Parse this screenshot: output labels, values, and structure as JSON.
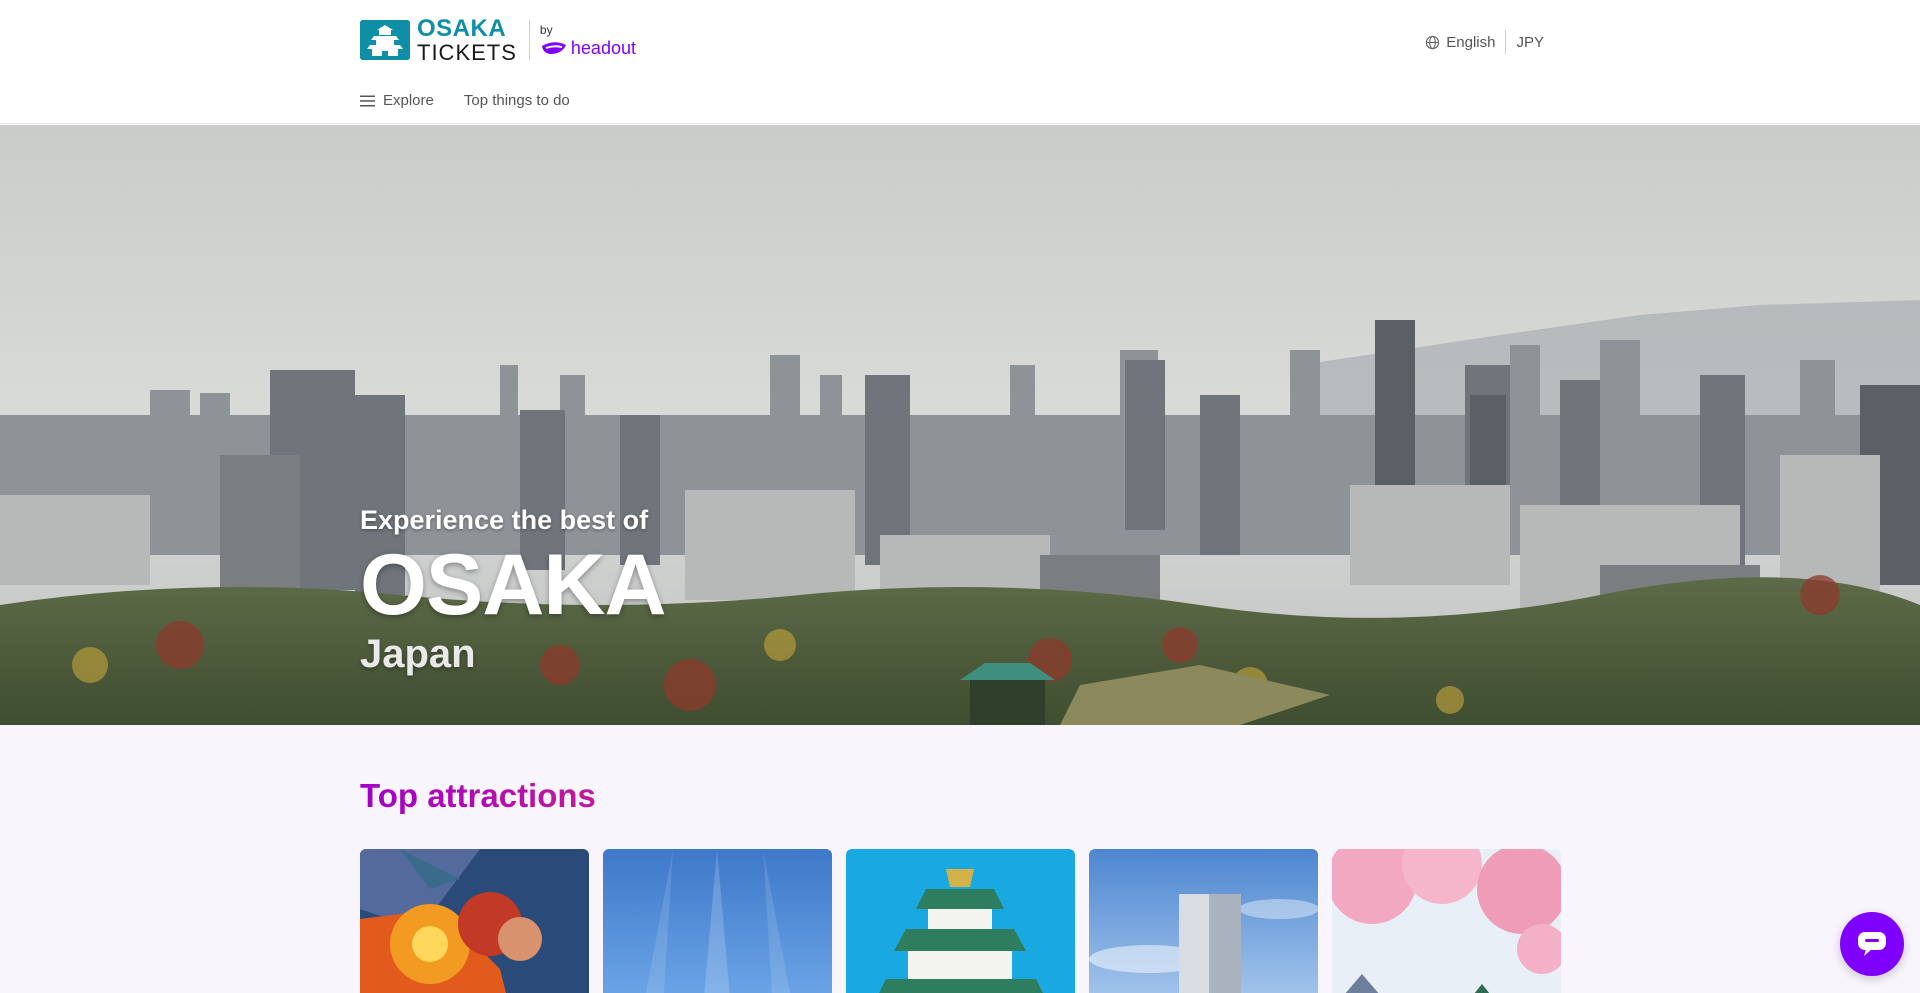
{
  "header": {
    "logo": {
      "line1": "OSAKA",
      "line2": "TICKETS",
      "by": "by",
      "brand": "headout"
    },
    "language": "English",
    "currency": "JPY",
    "nav": {
      "explore": "Explore",
      "top_things": "Top things to do"
    }
  },
  "hero": {
    "subtitle": "Experience the best of",
    "title": "OSAKA",
    "country": "Japan"
  },
  "section": {
    "title": "Top attractions",
    "cards": [
      {
        "name": "attraction-card-1"
      },
      {
        "name": "attraction-card-2"
      },
      {
        "name": "attraction-card-3"
      },
      {
        "name": "attraction-card-4"
      },
      {
        "name": "attraction-card-5"
      }
    ]
  },
  "colors": {
    "brand_teal": "#0e8fa6",
    "headout_purple": "#8000ff",
    "section_title": "#a300c6"
  },
  "icons": [
    "castle-icon",
    "headout-logo-icon",
    "globe-icon",
    "menu-icon",
    "chat-icon"
  ]
}
